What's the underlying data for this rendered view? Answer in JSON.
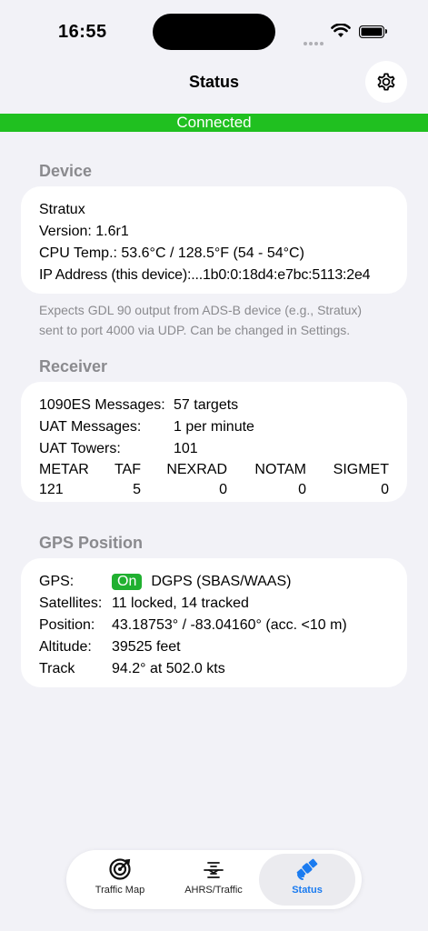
{
  "status_bar": {
    "time": "16:55"
  },
  "nav": {
    "title": "Status",
    "settings_icon": "gear-icon"
  },
  "connection": {
    "label": "Connected",
    "color": "#20c020"
  },
  "device": {
    "section_title": "Device",
    "name": "Stratux",
    "version": "Version: 1.6r1",
    "cpu_temp": "CPU Temp.: 53.6°C / 128.5°F (54 - 54°C)",
    "ip_address": "IP Address (this device):...1b0:0:18d4:e7bc:5113:2e4",
    "footnote_line1": "Expects GDL 90 output from ADS-B device (e.g., Stratux)",
    "footnote_line2": "sent to port 4000 via UDP. Can be changed in Settings."
  },
  "receiver": {
    "section_title": "Receiver",
    "rows": [
      {
        "label": "1090ES Messages:",
        "value": "57 targets"
      },
      {
        "label": "UAT Messages:",
        "value": "1 per minute"
      },
      {
        "label": "UAT Towers:",
        "value": "101"
      }
    ],
    "weather_headers": [
      "METAR",
      "TAF",
      "NEXRAD",
      "NOTAM",
      "SIGMET"
    ],
    "weather_values": [
      "121",
      "5",
      "0",
      "0",
      "0"
    ]
  },
  "gps": {
    "section_title": "GPS Position",
    "gps_label": "GPS:",
    "gps_state": "On",
    "gps_mode": "DGPS (SBAS/WAAS)",
    "satellites_label": "Satellites:",
    "satellites_value": "11 locked, 14 tracked",
    "position_label": "Position:",
    "position_value": "43.18753° / -83.04160° (acc. <10 m)",
    "altitude_label": "Altitude:",
    "altitude_value": "39525 feet",
    "track_label": "Track",
    "track_value": "94.2° at 502.0 kts"
  },
  "tabs": [
    {
      "label": "Traffic Map",
      "icon": "radar-target-icon",
      "active": false
    },
    {
      "label": "AHRS/Traffic",
      "icon": "attitude-indicator-icon",
      "active": false
    },
    {
      "label": "Status",
      "icon": "satellite-icon",
      "active": true
    }
  ],
  "colors": {
    "accent": "#1a7bf0",
    "connected": "#20c020",
    "gps_on": "#20b030"
  }
}
